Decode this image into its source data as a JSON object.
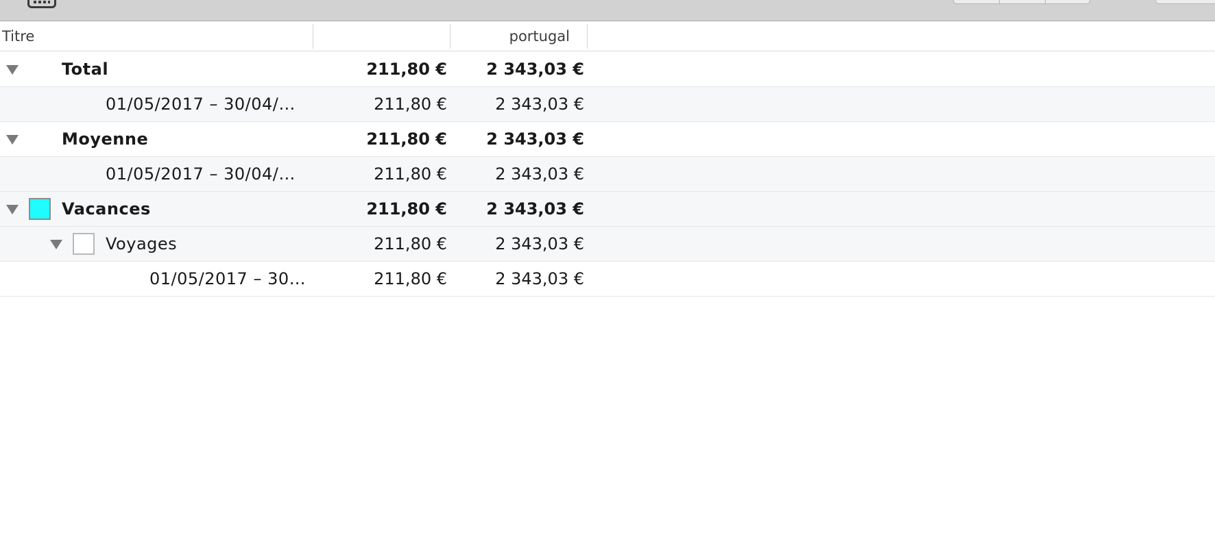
{
  "colors": {
    "vacances_swatch": "#1ffcff",
    "voyages_swatch": "#ffffff"
  },
  "toolbar": {
    "keyboard_icon": "keyboard-icon"
  },
  "table": {
    "headers": {
      "title": "Titre",
      "col1": "",
      "col2": "portugal"
    },
    "rows": [
      {
        "label": "Total",
        "col1": "211,80 €",
        "col2": "2 343,03 €"
      },
      {
        "label": "01/05/2017 – 30/04/…",
        "col1": "211,80 €",
        "col2": "2 343,03 €"
      },
      {
        "label": "Moyenne",
        "col1": "211,80 €",
        "col2": "2 343,03 €"
      },
      {
        "label": "01/05/2017 – 30/04/…",
        "col1": "211,80 €",
        "col2": "2 343,03 €"
      },
      {
        "label": "Vacances",
        "col1": "211,80 €",
        "col2": "2 343,03 €"
      },
      {
        "label": "Voyages",
        "col1": "211,80 €",
        "col2": "2 343,03 €"
      },
      {
        "label": "01/05/2017 – 30…",
        "col1": "211,80 €",
        "col2": "2 343,03 €"
      }
    ]
  }
}
